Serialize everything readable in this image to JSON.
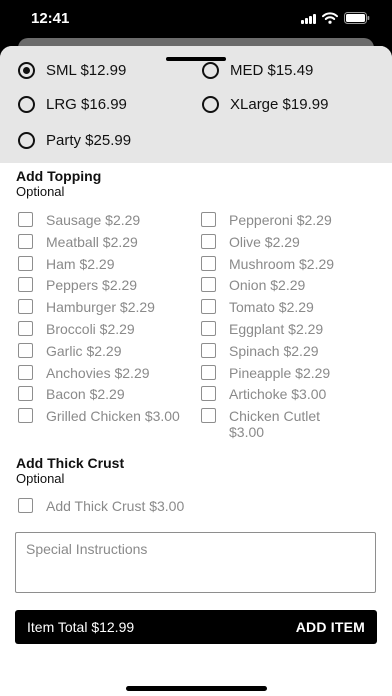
{
  "status_bar": {
    "time": "12:41"
  },
  "sizes": {
    "options": [
      {
        "label": "SML $12.99",
        "selected": true
      },
      {
        "label": "MED $15.49",
        "selected": false
      },
      {
        "label": "LRG $16.99",
        "selected": false
      },
      {
        "label": "XLarge $19.99",
        "selected": false
      },
      {
        "label": "Party $25.99",
        "selected": false
      }
    ]
  },
  "toppings": {
    "title": "Add Topping",
    "subtitle": "Optional",
    "left": [
      "Sausage $2.29",
      "Meatball $2.29",
      "Ham $2.29",
      "Peppers $2.29",
      "Hamburger $2.29",
      "Broccoli $2.29",
      "Garlic $2.29",
      "Anchovies $2.29",
      "Bacon $2.29",
      "Grilled Chicken $3.00"
    ],
    "right": [
      "Pepperoni $2.29",
      "Olive $2.29",
      "Mushroom $2.29",
      "Onion $2.29",
      "Tomato $2.29",
      "Eggplant $2.29",
      "Spinach $2.29",
      "Pineapple $2.29",
      "Artichoke $3.00",
      "Chicken Cutlet\n$3.00"
    ]
  },
  "crust": {
    "title": "Add Thick Crust",
    "subtitle": "Optional",
    "option": "Add Thick Crust $3.00"
  },
  "instructions": {
    "placeholder": "Special Instructions"
  },
  "footer": {
    "total_label": "Item Total $12.99",
    "add_label": "ADD ITEM"
  }
}
